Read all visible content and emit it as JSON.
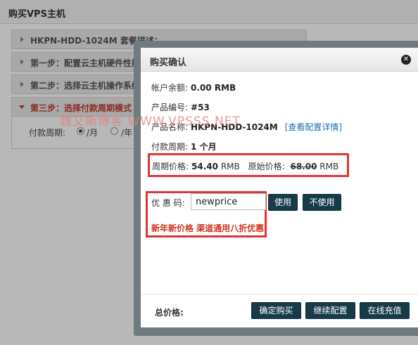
{
  "page": {
    "title": "购买VPS主机"
  },
  "accordion": {
    "items": [
      {
        "label": "HKPN-HDD-1024M 套餐描述："
      },
      {
        "label": "第一步：配置云主机硬件性能"
      },
      {
        "label": "第二步：选择云主机操作系统"
      },
      {
        "label": "第三步：选择付款周期模式"
      }
    ],
    "payment_period": {
      "label": "付款周期:",
      "options": [
        "/月",
        "/年"
      ],
      "selected": "/月"
    }
  },
  "modal": {
    "title": "购买确认",
    "close_icon": "close-icon",
    "rows": {
      "balance_label": "帐户余额:",
      "balance_value": "0.00 RMB",
      "product_id_label": "产品编号:",
      "product_id_value": "#53",
      "product_name_label": "产品名称:",
      "product_name_value": "HKPN-HDD-1024M",
      "config_link": "[查看配置详情]",
      "cycle_label": "付款周期:",
      "cycle_value": "1 个月",
      "period_price_label": "周期价格:",
      "period_price_value": "54.40",
      "period_price_unit": "RMB",
      "original_price_label": "原始价格:",
      "original_price_value": "68.00",
      "original_price_unit": "RMB"
    },
    "coupon": {
      "label": "优 惠 码:",
      "value": "newprice",
      "apply_button": "使用",
      "cancel_button": "不使用",
      "promo_text": "新年新价格 渠道通用八折优惠"
    },
    "footer": {
      "total_label": "总价格:",
      "buttons": [
        "确定购买",
        "继续配置",
        "在线充值"
      ]
    }
  },
  "watermark": "魏艾斯博客 WWW.VPSSS.NET",
  "colors": {
    "accent_red": "#e03434",
    "button_dark": "#173b49",
    "link_blue": "#1a6fb4",
    "promo_red": "#d0351f"
  }
}
